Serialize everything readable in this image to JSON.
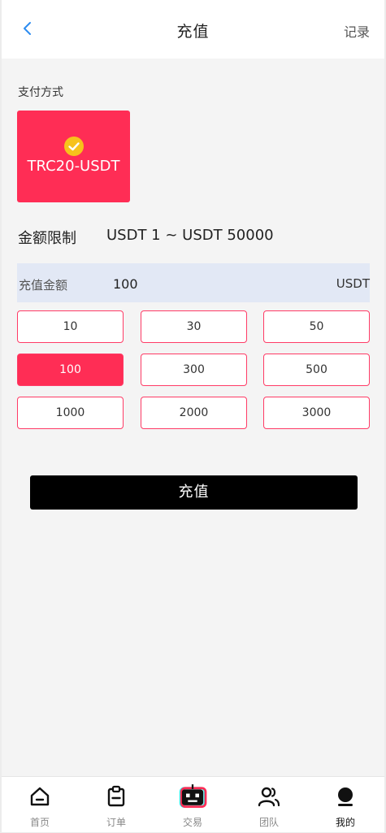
{
  "header": {
    "title": "充值",
    "record_label": "记录",
    "back_icon": "chevron-left-icon"
  },
  "payment": {
    "section_label": "支付方式",
    "method_name": "TRC20-USDT",
    "selected": true,
    "accent_color": "#ff2d55",
    "check_color": "#f7c21b"
  },
  "limit": {
    "label": "金额限制",
    "value": "USDT 1 ~ USDT 50000"
  },
  "amount": {
    "label": "充值金额",
    "value": "100",
    "unit": "USDT"
  },
  "presets": [
    {
      "label": "10",
      "selected": false
    },
    {
      "label": "30",
      "selected": false
    },
    {
      "label": "50",
      "selected": false
    },
    {
      "label": "100",
      "selected": true
    },
    {
      "label": "300",
      "selected": false
    },
    {
      "label": "500",
      "selected": false
    },
    {
      "label": "1000",
      "selected": false
    },
    {
      "label": "2000",
      "selected": false
    },
    {
      "label": "3000",
      "selected": false
    }
  ],
  "submit": {
    "label": "充值"
  },
  "nav": {
    "items": [
      {
        "label": "首页",
        "icon": "home-icon",
        "active": false
      },
      {
        "label": "订单",
        "icon": "clipboard-icon",
        "active": false
      },
      {
        "label": "交易",
        "icon": "robot-icon",
        "active": false
      },
      {
        "label": "团队",
        "icon": "users-icon",
        "active": false
      },
      {
        "label": "我的",
        "icon": "user-icon",
        "active": true
      }
    ]
  }
}
